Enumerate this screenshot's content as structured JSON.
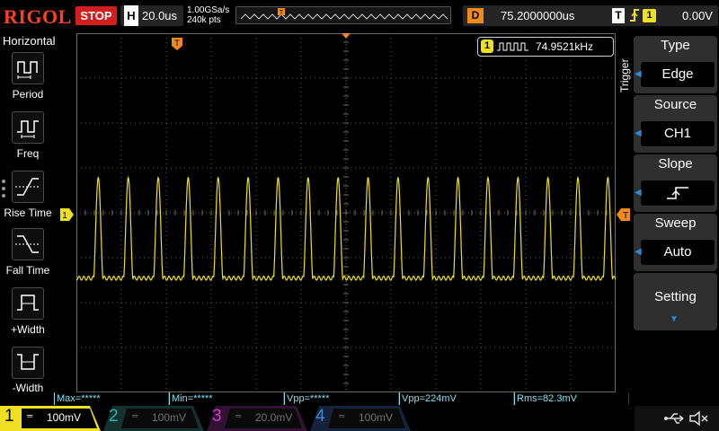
{
  "brand": "RIGOL",
  "run_state": "STOP",
  "horizontal": {
    "letter": "H",
    "timebase": "20.0us",
    "sample_rate": "1.00GSa/s",
    "memory_depth": "240k pts"
  },
  "delay": {
    "letter": "D",
    "value": "75.2000000us"
  },
  "trigger_status": {
    "letter": "T",
    "source_channel": "1",
    "level": "0.00V",
    "edge_icon": "rising-edge-icon"
  },
  "left_menu": {
    "title": "Horizontal",
    "items": [
      {
        "label": "Period",
        "icon": "period-icon"
      },
      {
        "label": "Freq",
        "icon": "freq-icon"
      },
      {
        "label": "Rise Time",
        "icon": "rise-time-icon"
      },
      {
        "label": "Fall Time",
        "icon": "fall-time-icon"
      },
      {
        "label": "+Width",
        "icon": "positive-width-icon"
      },
      {
        "label": "-Width",
        "icon": "negative-width-icon"
      }
    ]
  },
  "frequency_counter": {
    "channel": "1",
    "value": "74.9521kHz"
  },
  "right_menu": {
    "vertical_title": "Trigger",
    "items": [
      {
        "title": "Type",
        "value": "Edge"
      },
      {
        "title": "Source",
        "value": "CH1"
      },
      {
        "title": "Slope",
        "value_icon": "rising-slope-icon"
      },
      {
        "title": "Sweep",
        "value": "Auto"
      },
      {
        "title": "Setting"
      }
    ]
  },
  "measurements": [
    "Max=*****",
    "Min=*****",
    "Vpp=*****",
    "Vpp=224mV",
    "Rms=82.3mV"
  ],
  "channels": [
    {
      "number": "1",
      "coupling": "═",
      "scale": "100mV",
      "active": true
    },
    {
      "number": "2",
      "coupling": "═",
      "scale": "100mV",
      "active": false
    },
    {
      "number": "3",
      "coupling": "═",
      "scale": "20.0mV",
      "active": false
    },
    {
      "number": "4",
      "coupling": "═",
      "scale": "100mV",
      "active": false
    }
  ],
  "markers": {
    "channel1": "1",
    "trigger_pos": "T"
  },
  "colors": {
    "ch1": "#f0e020",
    "ch2": "#1fb5b5",
    "ch3": "#d23cd2",
    "ch4": "#3a8ad6",
    "trigger": "#f08a1a",
    "brand": "#ff4020",
    "stop": "#d41e1e",
    "measure": "#7fe0f0",
    "menu_accent": "#2a8ad6"
  },
  "waveform": {
    "channel": "1",
    "frequency_hz": 74952.1,
    "vpp_v": 0.224,
    "vertical_scale_v_per_div": 0.1,
    "timebase_s_per_div": 2e-05
  }
}
